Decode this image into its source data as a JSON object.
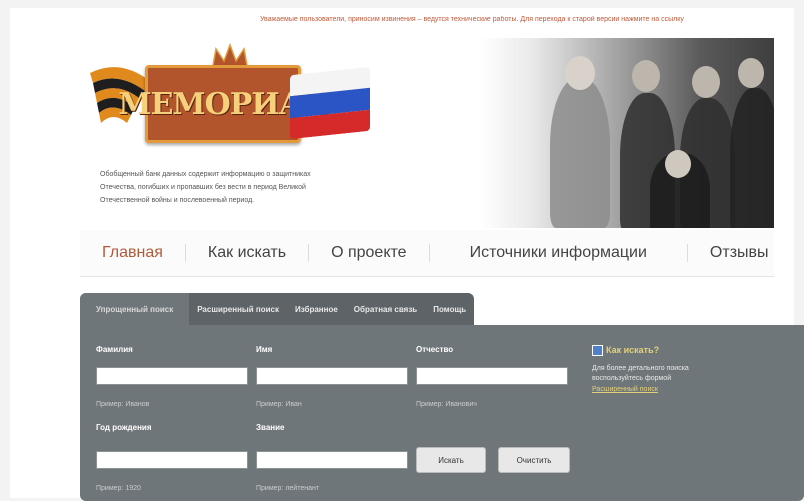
{
  "notice": "Уважаемые пользователи, приносим извинения – ведутся технические работы. Для перехода к старой версии нажмите на ссылку",
  "logo": {
    "text": "МЕМОРИАЛ",
    "colors": {
      "plate": "#b2552c",
      "text": "#f6d07a",
      "ribbon_orange": "#e08a1e",
      "ribbon_black": "#1e1e1e"
    }
  },
  "tagline": [
    "Обобщенный банк данных содержит информацию о защитниках",
    "Отечества, погибших и пропавших без вести в период Великой",
    "Отечественной войны и послевоенный период."
  ],
  "nav": {
    "items": [
      {
        "label": "Главная",
        "active": true
      },
      {
        "label": "Как искать",
        "active": false
      },
      {
        "label": "О проекте",
        "active": false
      },
      {
        "label": "Источники информации",
        "active": false
      },
      {
        "label": "Отзывы",
        "active": false
      }
    ]
  },
  "search": {
    "tabs": [
      {
        "label": "Упрощенный поиск",
        "active": true
      },
      {
        "label": "Расширенный поиск",
        "active": false
      },
      {
        "label": "Избранное",
        "active": false
      },
      {
        "label": "Обратная связь",
        "active": false
      },
      {
        "label": "Помощь",
        "active": false
      }
    ],
    "fields": {
      "surname": {
        "label": "Фамилия",
        "value": "",
        "hint": "Пример: Иванов"
      },
      "name": {
        "label": "Имя",
        "value": "",
        "hint": "Пример: Иван"
      },
      "patronymic": {
        "label": "Отчество",
        "value": "",
        "hint": "Пример: Иванович"
      },
      "birth_year": {
        "label": "Год рождения",
        "value": "",
        "hint": "Пример: 1920"
      },
      "rank": {
        "label": "Звание",
        "value": "",
        "hint": "Пример: лейтенант"
      }
    },
    "buttons": {
      "search": "Искать",
      "clear": "Очистить"
    },
    "info": {
      "title": "Как искать?",
      "text": "Для более детального поиска воспользуйтесь формой",
      "link": "Расширенный поиск"
    }
  }
}
